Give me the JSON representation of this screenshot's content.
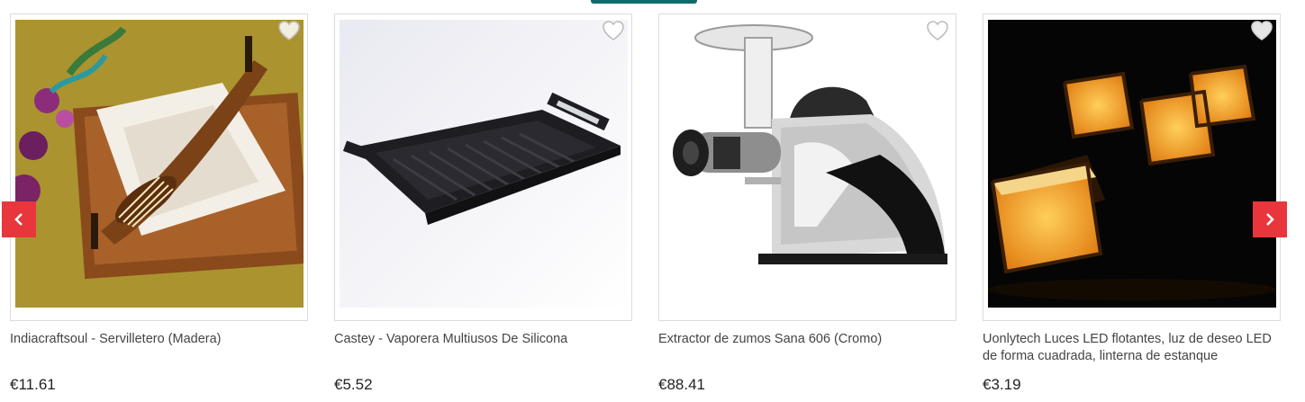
{
  "products": [
    {
      "title": "Indiacraftsoul - Servilletero (Madera)",
      "price": "€11.61",
      "image": "wooden-napkin-holder"
    },
    {
      "title": "Castey - Vaporera Multiusos De Silicona",
      "price": "€5.52",
      "image": "black-grill-tray"
    },
    {
      "title": "Extractor de zumos Sana 606 (Cromo)",
      "price": "€88.41",
      "image": "juicer"
    },
    {
      "title": "Uonlytech Luces LED flotantes, luz de deseo LED de forma cuadrada, linterna de estanque",
      "price": "€3.19",
      "image": "floating-lanterns"
    }
  ],
  "carousel": {
    "prev_icon": "chevron-left-icon",
    "next_icon": "chevron-right-icon",
    "arrow_color": "#e8363c"
  },
  "favorite_icon": "heart-icon"
}
